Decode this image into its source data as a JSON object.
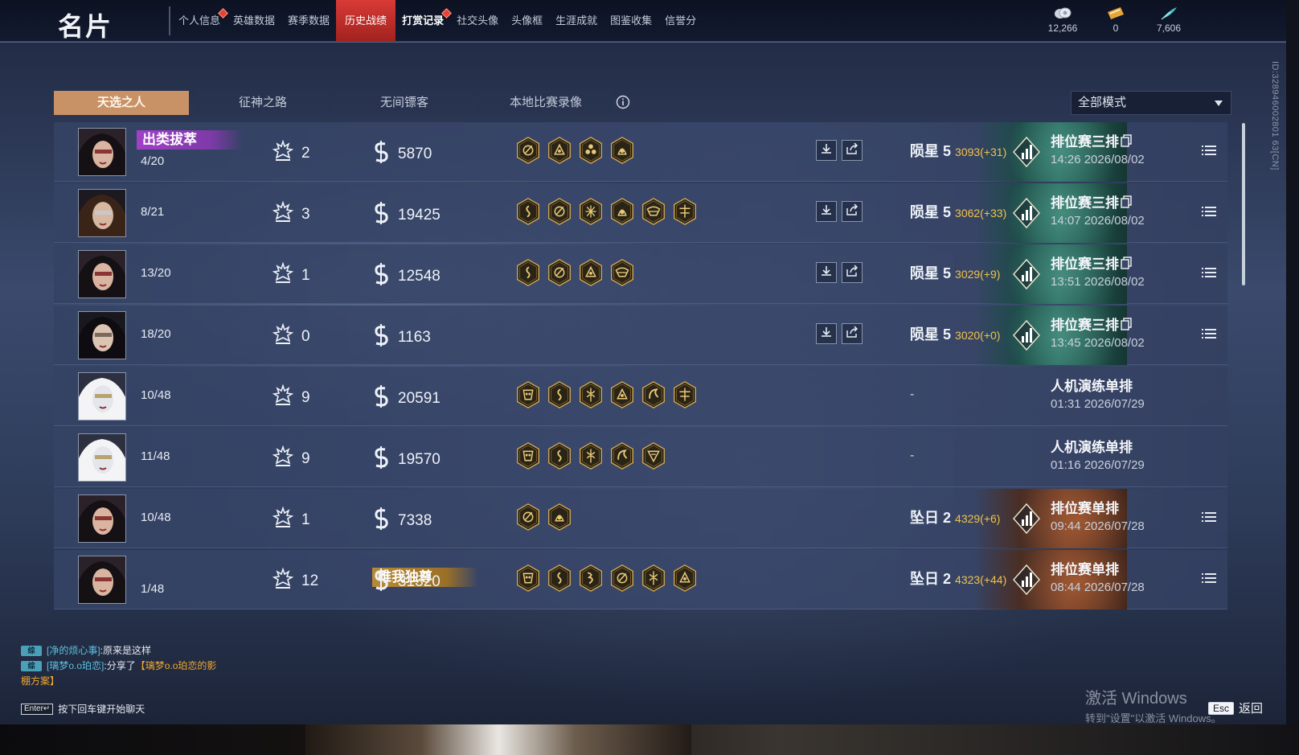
{
  "header": {
    "title": "名片",
    "tabs": [
      {
        "label": "个人信息",
        "active": false,
        "bold": false,
        "dot": true
      },
      {
        "label": "英雄数据",
        "active": false,
        "bold": false,
        "dot": false
      },
      {
        "label": "赛季数据",
        "active": false,
        "bold": false,
        "dot": false
      },
      {
        "label": "历史战绩",
        "active": true,
        "bold": false,
        "dot": false
      },
      {
        "label": "打赏记录",
        "active": false,
        "bold": true,
        "dot": true
      },
      {
        "label": "社交头像",
        "active": false,
        "bold": false,
        "dot": false
      },
      {
        "label": "头像框",
        "active": false,
        "bold": false,
        "dot": false
      },
      {
        "label": "生涯成就",
        "active": false,
        "bold": false,
        "dot": false
      },
      {
        "label": "图鉴收集",
        "active": false,
        "bold": false,
        "dot": false
      },
      {
        "label": "信誉分",
        "active": false,
        "bold": false,
        "dot": false
      }
    ],
    "currencies": [
      {
        "icon": "coins-icon",
        "value": "12,266"
      },
      {
        "icon": "ticket-icon",
        "value": "0"
      },
      {
        "icon": "feather-icon",
        "value": "7,606"
      }
    ]
  },
  "side_id": "ID:328946002801 63[CN]",
  "subtabs": [
    "天选之人",
    "征神之路",
    "无间镖客",
    "本地比赛录像"
  ],
  "active_subtab": 0,
  "mode_filter": "全部模式",
  "matches": [
    {
      "avatar": "female-eyepatch",
      "honor": "出类拔萃",
      "honor_color": "purple",
      "rank": "4/20",
      "kills": "2",
      "gold": "5870",
      "badges": [
        "crest-b",
        "crest-c",
        "crest-d",
        "crest-e"
      ],
      "has_actions": true,
      "tier": "陨星 5",
      "points": "3093(+31)",
      "tier_art": "star",
      "mode": "排位赛三排",
      "card": true,
      "time": "14:26  2026/08/02"
    },
    {
      "avatar": "male-swordsman",
      "honor": "",
      "honor_color": "",
      "rank": "8/21",
      "kills": "3",
      "gold": "19425",
      "badges": [
        "crest-a",
        "crest-b",
        "crest-f",
        "crest-e",
        "crest-g",
        "crest-h"
      ],
      "has_actions": true,
      "tier": "陨星 5",
      "points": "3062(+33)",
      "tier_art": "star",
      "mode": "排位赛三排",
      "card": true,
      "time": "14:07  2026/08/02"
    },
    {
      "avatar": "female-eyepatch",
      "honor": "",
      "honor_color": "",
      "rank": "13/20",
      "kills": "1",
      "gold": "12548",
      "badges": [
        "crest-a",
        "crest-b",
        "crest-c",
        "crest-g"
      ],
      "has_actions": true,
      "tier": "陨星 5",
      "points": "3029(+9)",
      "tier_art": "star",
      "mode": "排位赛三排",
      "card": true,
      "time": "13:51  2026/08/02"
    },
    {
      "avatar": "female-dark",
      "honor": "",
      "honor_color": "",
      "rank": "18/20",
      "kills": "0",
      "gold": "1163",
      "badges": [],
      "has_actions": true,
      "tier": "陨星 5",
      "points": "3020(+0)",
      "tier_art": "star",
      "mode": "排位赛三排",
      "card": true,
      "time": "13:45  2026/08/02"
    },
    {
      "avatar": "female-masked",
      "honor": "",
      "honor_color": "",
      "rank": "10/48",
      "kills": "9",
      "gold": "20591",
      "badges": [
        "crest-i",
        "crest-a",
        "crest-j",
        "crest-c",
        "crest-k",
        "crest-h"
      ],
      "has_actions": false,
      "tier": "-",
      "points": "",
      "tier_art": "",
      "mode": "人机演练单排",
      "card": false,
      "time": "01:31  2026/07/29"
    },
    {
      "avatar": "female-masked",
      "honor": "",
      "honor_color": "",
      "rank": "11/48",
      "kills": "9",
      "gold": "19570",
      "badges": [
        "crest-i",
        "crest-a",
        "crest-j",
        "crest-k",
        "crest-l"
      ],
      "has_actions": false,
      "tier": "-",
      "points": "",
      "tier_art": "",
      "mode": "人机演练单排",
      "card": false,
      "time": "01:16  2026/07/29"
    },
    {
      "avatar": "female-eyepatch",
      "honor": "",
      "honor_color": "",
      "rank": "10/48",
      "kills": "1",
      "gold": "7338",
      "badges": [
        "crest-b",
        "crest-e"
      ],
      "has_actions": false,
      "tier": "坠日 2",
      "points": "4329(+6)",
      "tier_art": "sun",
      "mode": "排位赛单排",
      "card": false,
      "time": "09:44  2026/07/28"
    },
    {
      "avatar": "female-eyepatch",
      "honor": "唯我独尊",
      "honor_color": "gold",
      "rank": "1/48",
      "kills": "12",
      "gold": "31320",
      "badges": [
        "crest-i",
        "crest-a",
        "crest-m",
        "crest-b",
        "crest-j",
        "crest-c"
      ],
      "has_actions": false,
      "tier": "坠日 2",
      "points": "4323(+44)",
      "tier_art": "sun",
      "mode": "排位赛单排",
      "card": false,
      "time": "08:44  2026/07/28"
    }
  ],
  "chat": {
    "lines": [
      {
        "tag": "综",
        "who": "[净的烦心事]",
        "text": ":原来是这样",
        "share": ""
      },
      {
        "tag": "综",
        "who": "[璃梦o.o珀恋]",
        "text": ":分享了",
        "share": "【璃梦o.o珀恋的影"
      }
    ],
    "continuation": "棚方案】",
    "hint_key": "Enter↵",
    "hint_text": "按下回车键开始聊天"
  },
  "watermark": {
    "line1": "激活 Windows",
    "line2": "转到\"设置\"以激活 Windows。"
  },
  "back": {
    "key": "Esc",
    "label": "返回"
  },
  "colors": {
    "accent_red": "#c92c29",
    "active_subtab": "#c89166",
    "points_gold": "#f1c24a",
    "honor_purple": "#a040c8",
    "honor_gold": "#b88a36"
  }
}
